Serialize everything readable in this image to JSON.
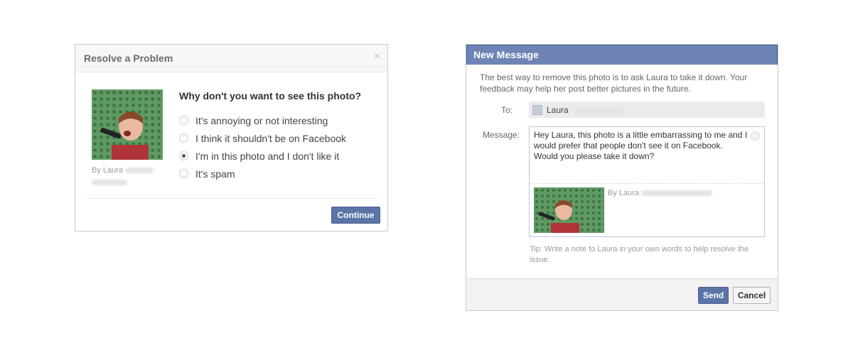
{
  "resolve_dialog": {
    "title": "Resolve a Problem",
    "close_glyph": "×",
    "photo_byline": "By Laura",
    "question": "Why don't you want to see this photo?",
    "options": [
      {
        "label": "It's annoying or not interesting",
        "selected": false
      },
      {
        "label": "I think it shouldn't be on Facebook",
        "selected": false
      },
      {
        "label": "I'm in this photo and I don't like it",
        "selected": true
      },
      {
        "label": "It's spam",
        "selected": false
      }
    ],
    "continue_label": "Continue"
  },
  "message_dialog": {
    "title": "New Message",
    "intro": "The best way to remove this photo is to ask Laura to take it down. Your feedback may help her post better pictures in the future.",
    "to_label": "To:",
    "to_name": "Laura",
    "message_label": "Message:",
    "message_text": "Hey Laura, this photo is a little embarrassing to me and I would prefer that people don't see it on Facebook. Would you please take it down?",
    "attachment_byline": "By Laura",
    "tip": "Tip: Write a note to Laura in your own words to help resolve the issue.",
    "send_label": "Send",
    "cancel_label": "Cancel"
  },
  "colors": {
    "header_blue": "#6d84b4",
    "button_blue": "#5b74a8",
    "photo_background_green": "#5e9a62"
  }
}
